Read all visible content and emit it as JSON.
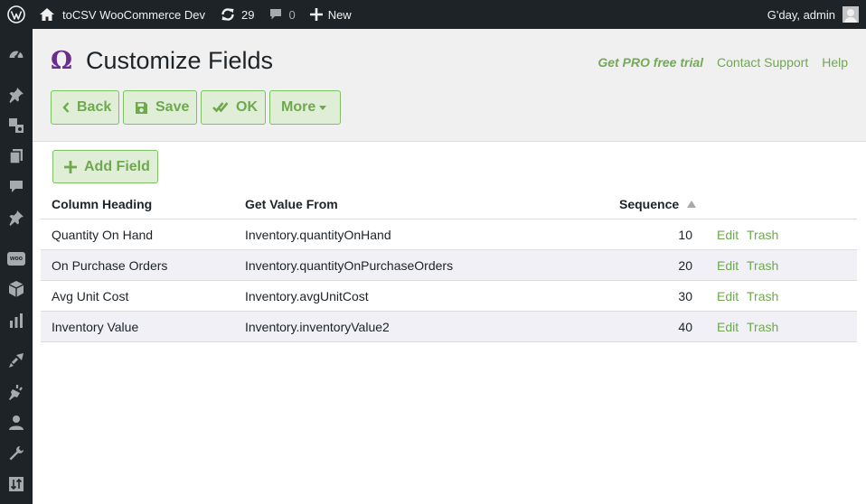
{
  "admin_bar": {
    "site_name": "toCSV WooCommerce Dev",
    "updates_count": "29",
    "comments_count": "0",
    "new_label": "New",
    "greeting": "G'day, admin"
  },
  "admin_menu": {
    "icons": [
      "dashboard-icon",
      "pin-icon",
      "media-icon",
      "pages-icon",
      "comments-icon",
      "pin-icon",
      "woo-icon",
      "box-icon",
      "chart-icon",
      "brush-icon",
      "plugin-icon",
      "user-icon",
      "wrench-icon",
      "sort-icon"
    ],
    "woo_label": "woo"
  },
  "header": {
    "title": "Customize Fields",
    "links": {
      "pro": "Get PRO free trial",
      "support": "Contact Support",
      "help": "Help"
    }
  },
  "toolbar": {
    "back_label": "Back",
    "save_label": "Save",
    "ok_label": "OK",
    "more_label": "More"
  },
  "add_field_label": "Add Field",
  "table": {
    "headers": {
      "column_heading": "Column Heading",
      "get_value_from": "Get Value From",
      "sequence": "Sequence"
    },
    "rows": [
      {
        "heading": "Quantity On Hand",
        "source": "Inventory.quantityOnHand",
        "sequence": "10",
        "edit": "Edit",
        "trash": "Trash"
      },
      {
        "heading": "On Purchase Orders",
        "source": "Inventory.quantityOnPurchaseOrders",
        "sequence": "20",
        "edit": "Edit",
        "trash": "Trash"
      },
      {
        "heading": "Avg Unit Cost",
        "source": "Inventory.avgUnitCost",
        "sequence": "30",
        "edit": "Edit",
        "trash": "Trash"
      },
      {
        "heading": "Inventory Value",
        "source": "Inventory.inventoryValue2",
        "sequence": "40",
        "edit": "Edit",
        "trash": "Trash"
      }
    ]
  },
  "colors": {
    "accent_green": "#6fa84f",
    "button_bg": "#e0eed7",
    "omega_purple": "#6b2c91",
    "admin_dark": "#1d2327"
  }
}
